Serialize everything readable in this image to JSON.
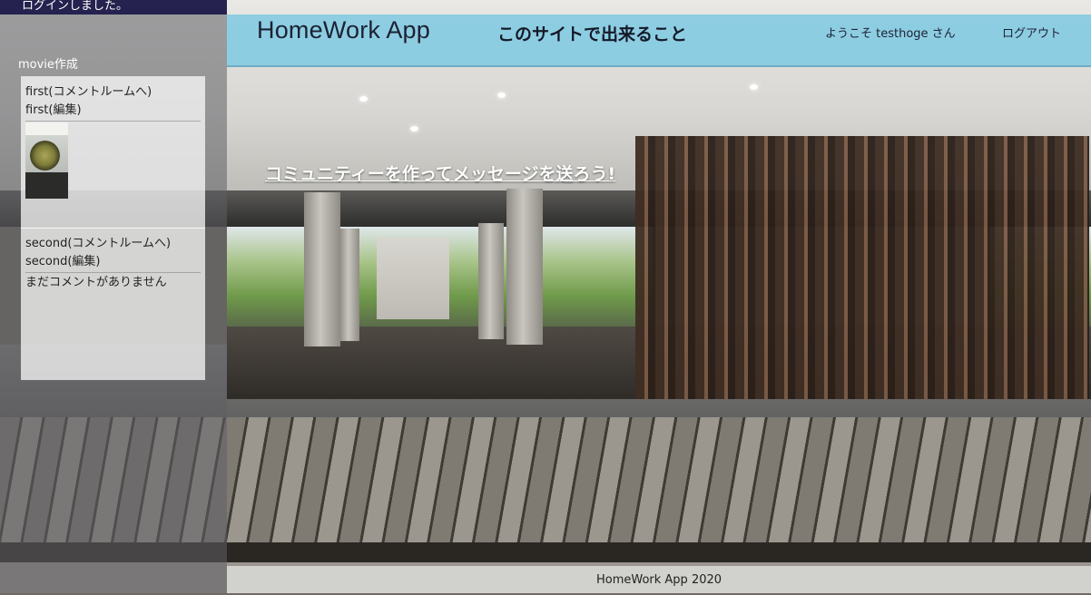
{
  "flash": {
    "message": "ログインしました。"
  },
  "header": {
    "brand": "HomeWork App",
    "about_link": "このサイトで出来ること",
    "welcome": "ようこそ testhoge さん",
    "logout": "ログアウト",
    "accent_color": "#87CBE2"
  },
  "sidebar": {
    "create_link": "movie作成",
    "movies": [
      {
        "room_link": "first(コメントルームへ)",
        "edit_link": "first(編集)",
        "thumbnail": "jar-of-pickles-photo"
      },
      {
        "room_link": "second(コメントルームへ)",
        "edit_link": "second(編集)",
        "empty_comment": "まだコメントがありません"
      }
    ]
  },
  "main": {
    "hero_link": "コミュニティーを作ってメッセージを送ろう!"
  },
  "footer": {
    "text": "HomeWork App 2020"
  },
  "colors": {
    "flash_bg": "#25224F",
    "header_bg": "#87CBE2"
  }
}
